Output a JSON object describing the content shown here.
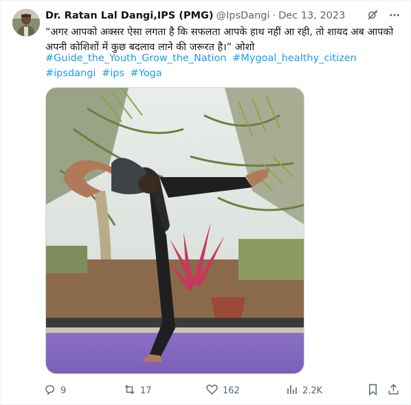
{
  "tweet": {
    "author_name": "Dr. Ratan Lal Dangi,IPS (PMG)",
    "handle": "@IpsDangi",
    "separator": "·",
    "date": "Dec 13, 2023",
    "text": "“अगर आपको अक्सर ऐसा लगता है कि सफलता आपके हाथ नहीं आ रही, तो शायद अब आपको अपनी कोशिशों में कुछ बदलाव लाने की जरूरत है।” ओशो",
    "hashtags": [
      "#Guide_the_Youth_Grow_the_Nation",
      "#Mygoal_healthy_citizen",
      "#ipsdangi",
      "#ips",
      "#Yoga"
    ],
    "link_color": "#1d9bf0"
  },
  "actions": {
    "replies": "9",
    "reposts": "17",
    "likes": "162",
    "views": "2.2K"
  },
  "icons": {
    "grok": "grok-icon",
    "more": "more-icon",
    "reply": "reply-icon",
    "repost": "repost-icon",
    "like": "heart-icon",
    "views": "views-icon",
    "bookmark": "bookmark-icon",
    "share": "share-icon"
  }
}
